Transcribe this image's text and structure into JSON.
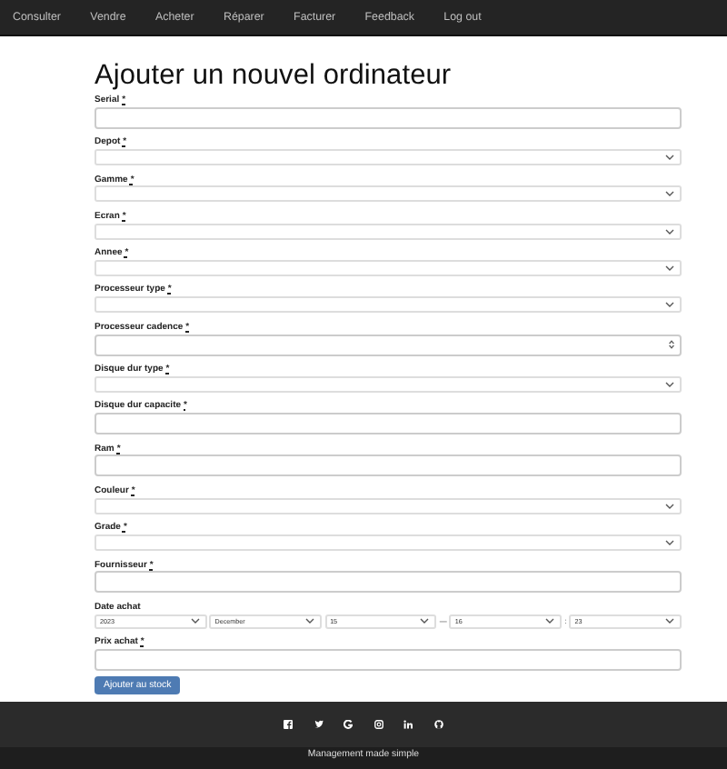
{
  "nav": {
    "items": [
      {
        "label": "Consulter"
      },
      {
        "label": "Vendre"
      },
      {
        "label": "Acheter"
      },
      {
        "label": "Réparer"
      },
      {
        "label": "Facturer"
      },
      {
        "label": "Feedback"
      },
      {
        "label": "Log out"
      }
    ]
  },
  "title": "Ajouter un nouvel ordinateur",
  "required_mark": "*",
  "fields": [
    {
      "label": "Serial",
      "required": true,
      "kind": "text"
    },
    {
      "label": "Depot",
      "required": true,
      "kind": "select"
    },
    {
      "label": "Gamme",
      "required": true,
      "kind": "select"
    },
    {
      "label": "Ecran",
      "required": true,
      "kind": "select"
    },
    {
      "label": "Annee",
      "required": true,
      "kind": "select"
    },
    {
      "label": "Processeur type",
      "required": true,
      "kind": "select"
    },
    {
      "label": "Processeur cadence",
      "required": true,
      "kind": "number"
    },
    {
      "label": "Disque dur type",
      "required": true,
      "kind": "select"
    },
    {
      "label": "Disque dur capacite",
      "required": true,
      "kind": "text"
    },
    {
      "label": "Ram",
      "required": true,
      "kind": "text"
    },
    {
      "label": "Couleur",
      "required": true,
      "kind": "select"
    },
    {
      "label": "Grade",
      "required": true,
      "kind": "select"
    },
    {
      "label": "Fournisseur",
      "required": true,
      "kind": "text"
    },
    {
      "label": "Date achat",
      "required": false,
      "kind": "datetime",
      "parts": [
        {
          "kind": "select",
          "value": "2023"
        },
        {
          "kind": "select",
          "value": "December"
        },
        {
          "kind": "select",
          "value": "15"
        },
        {
          "kind": "sep",
          "value": "—"
        },
        {
          "kind": "select",
          "value": "16"
        },
        {
          "kind": "sep",
          "value": ":"
        },
        {
          "kind": "select",
          "value": "23"
        }
      ]
    },
    {
      "label": "Prix achat",
      "required": true,
      "kind": "text"
    }
  ],
  "submit": "Ajouter au stock",
  "footer": {
    "tagline": "Management made simple"
  }
}
